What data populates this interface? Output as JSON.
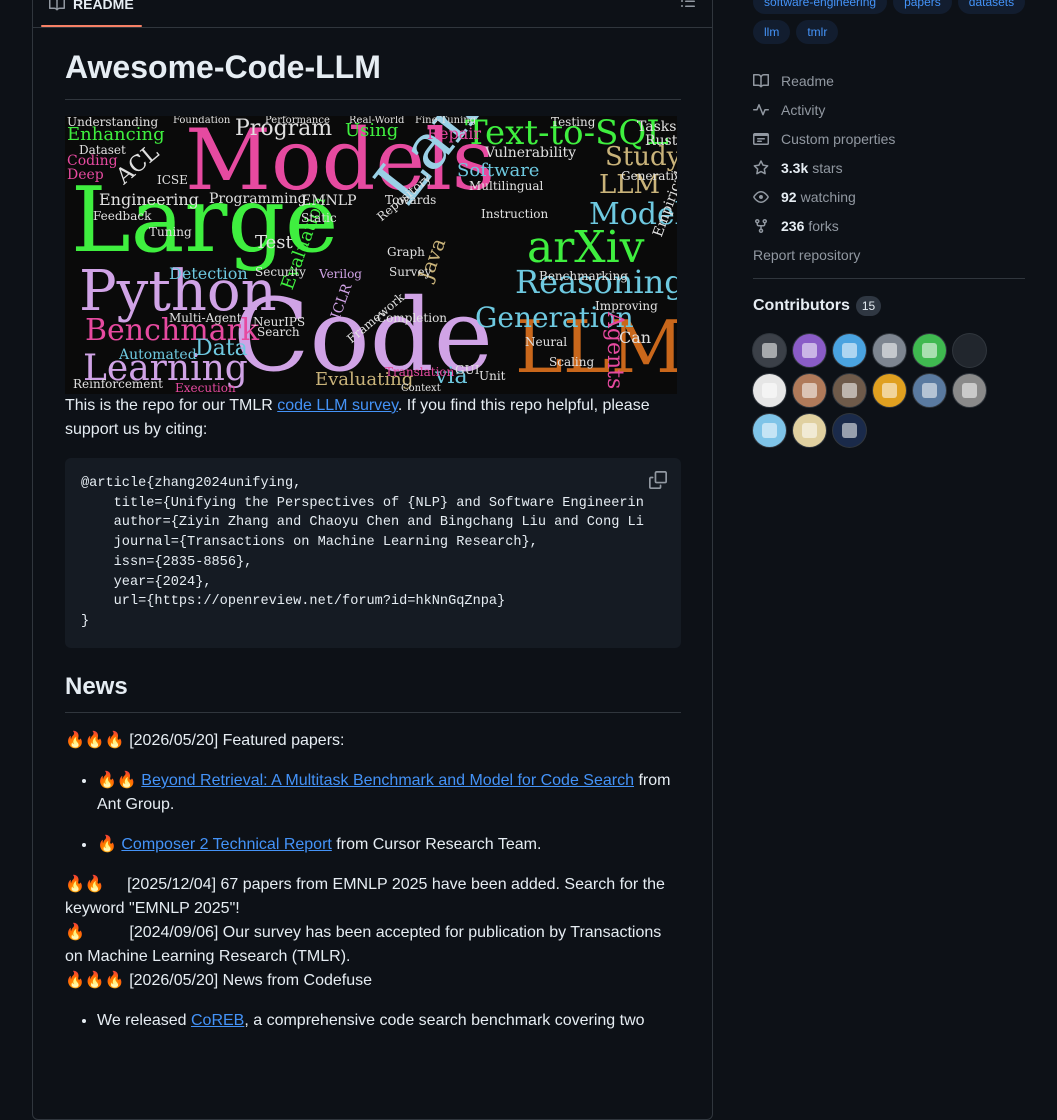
{
  "readme": {
    "tab_label": "README",
    "title": "Awesome-Code-LLM",
    "intro_before": "This is the repo for our TMLR ",
    "intro_link": "code LLM survey",
    "intro_after": ". If you find this repo helpful, please support us by citing:",
    "citation": "@article{zhang2024unifying,\n    title={Unifying the Perspectives of {NLP} and Software Engineerin\n    author={Ziyin Zhang and Chaoyu Chen and Bingchang Liu and Cong Li\n    journal={Transactions on Machine Learning Research},\n    issn={2835-8856},\n    year={2024},\n    url={https://openreview.net/forum?id=hkNnGqZnpa}\n}",
    "news_heading": "News",
    "news1": "🔥🔥🔥 [2026/05/20] Featured papers:",
    "news1_items": [
      {
        "prefix": "🔥🔥 ",
        "link": "Beyond Retrieval: A Multitask Benchmark and Model for Code Search",
        "suffix": " from Ant Group."
      },
      {
        "prefix": "🔥 ",
        "link": "Composer 2 Technical Report",
        "suffix": " from Cursor Research Team."
      }
    ],
    "news2": "🔥🔥     [2025/12/04] 67 papers from EMNLP 2025 have been added. Search for the keyword \"EMNLP 2025\"!",
    "news3": "🔥          [2024/09/06] Our survey has been accepted for publication by Transactions on Machine Learning Research (TMLR).",
    "news4": "🔥🔥🔥 [2026/05/20] News from Codefuse",
    "news4_item_prefix": "We released ",
    "news4_item_link": "CoREB",
    "news4_item_suffix": ", a comprehensive code search benchmark covering two"
  },
  "wordcloud": {
    "words": [
      "Models",
      "Large",
      "Code",
      "Language",
      "LLMs",
      "Python",
      "Learning",
      "Benchmark",
      "arXiv",
      "Reasoning",
      "Generation",
      "Text-to-SQL",
      "Program",
      "Study",
      "LLM",
      "Model",
      "Software",
      "Agents",
      "Enhancing",
      "Data",
      "Detection",
      "Evaluating",
      "Engineering",
      "Programming",
      "Automated",
      "Test",
      "Vulnerability",
      "Repair",
      "Using",
      "Dataset",
      "Coding",
      "Deep",
      "Understanding",
      "Evaluation",
      "Java",
      "via",
      "Multilingual",
      "Towards",
      "Benchmarking",
      "Improving",
      "ICLR",
      "Verilog",
      "Reinforcement",
      "Multi-Agent",
      "Instruction",
      "Tuning",
      "Framework",
      "Feedback",
      "Repository",
      "Translation",
      "Completion",
      "Static",
      "Security",
      "Testing",
      "Rust",
      "Tasks",
      "Fine-Tuning",
      "Real-World",
      "Performance",
      "Foundation",
      "ACL",
      "ICSE",
      "EMNLP",
      "NeurIPS",
      "Survey",
      "Generative",
      "Empirical",
      "Neural",
      "Unit",
      "GUI",
      "Context",
      "Scaling",
      "Search",
      "Execution",
      "Can",
      "Graph"
    ],
    "colors": [
      "#e64aa0",
      "#3fef3f",
      "#d0a3e6",
      "#9ad0e6",
      "#c9671b",
      "#6ec9e0",
      "#e0e0e0",
      "#c9b37a"
    ]
  },
  "sidebar": {
    "topics": [
      "software-engineering",
      "papers",
      "datasets",
      "llm",
      "tmlr"
    ],
    "links": [
      {
        "icon": "book-icon",
        "label": "Readme"
      },
      {
        "icon": "activity-icon",
        "label": "Activity"
      },
      {
        "icon": "custom-properties-icon",
        "label": "Custom properties"
      },
      {
        "icon": "star-icon",
        "value": "3.3k",
        "label": "stars"
      },
      {
        "icon": "eye-icon",
        "value": "92",
        "label": "watching"
      },
      {
        "icon": "fork-icon",
        "value": "236",
        "label": "forks"
      }
    ],
    "report": "Report repository",
    "contributors_label": "Contributors",
    "contributors_count": "15",
    "avatar_colors": [
      "#3b4048",
      "#8a5cc7",
      "#4aa3e0",
      "#7d8590",
      "#3fb950",
      "#21262d",
      "#e6e6e6",
      "#b07a5a",
      "#6e5a4a",
      "#e0a020",
      "#5a7aa0",
      "#8a8a8a",
      "#7fc4e8",
      "#e0d0a0",
      "#1a2a4a"
    ]
  },
  "colors": {
    "accent": "#4493f8",
    "bg": "#0d1117",
    "border": "#30363d",
    "underline": "#f78166"
  }
}
